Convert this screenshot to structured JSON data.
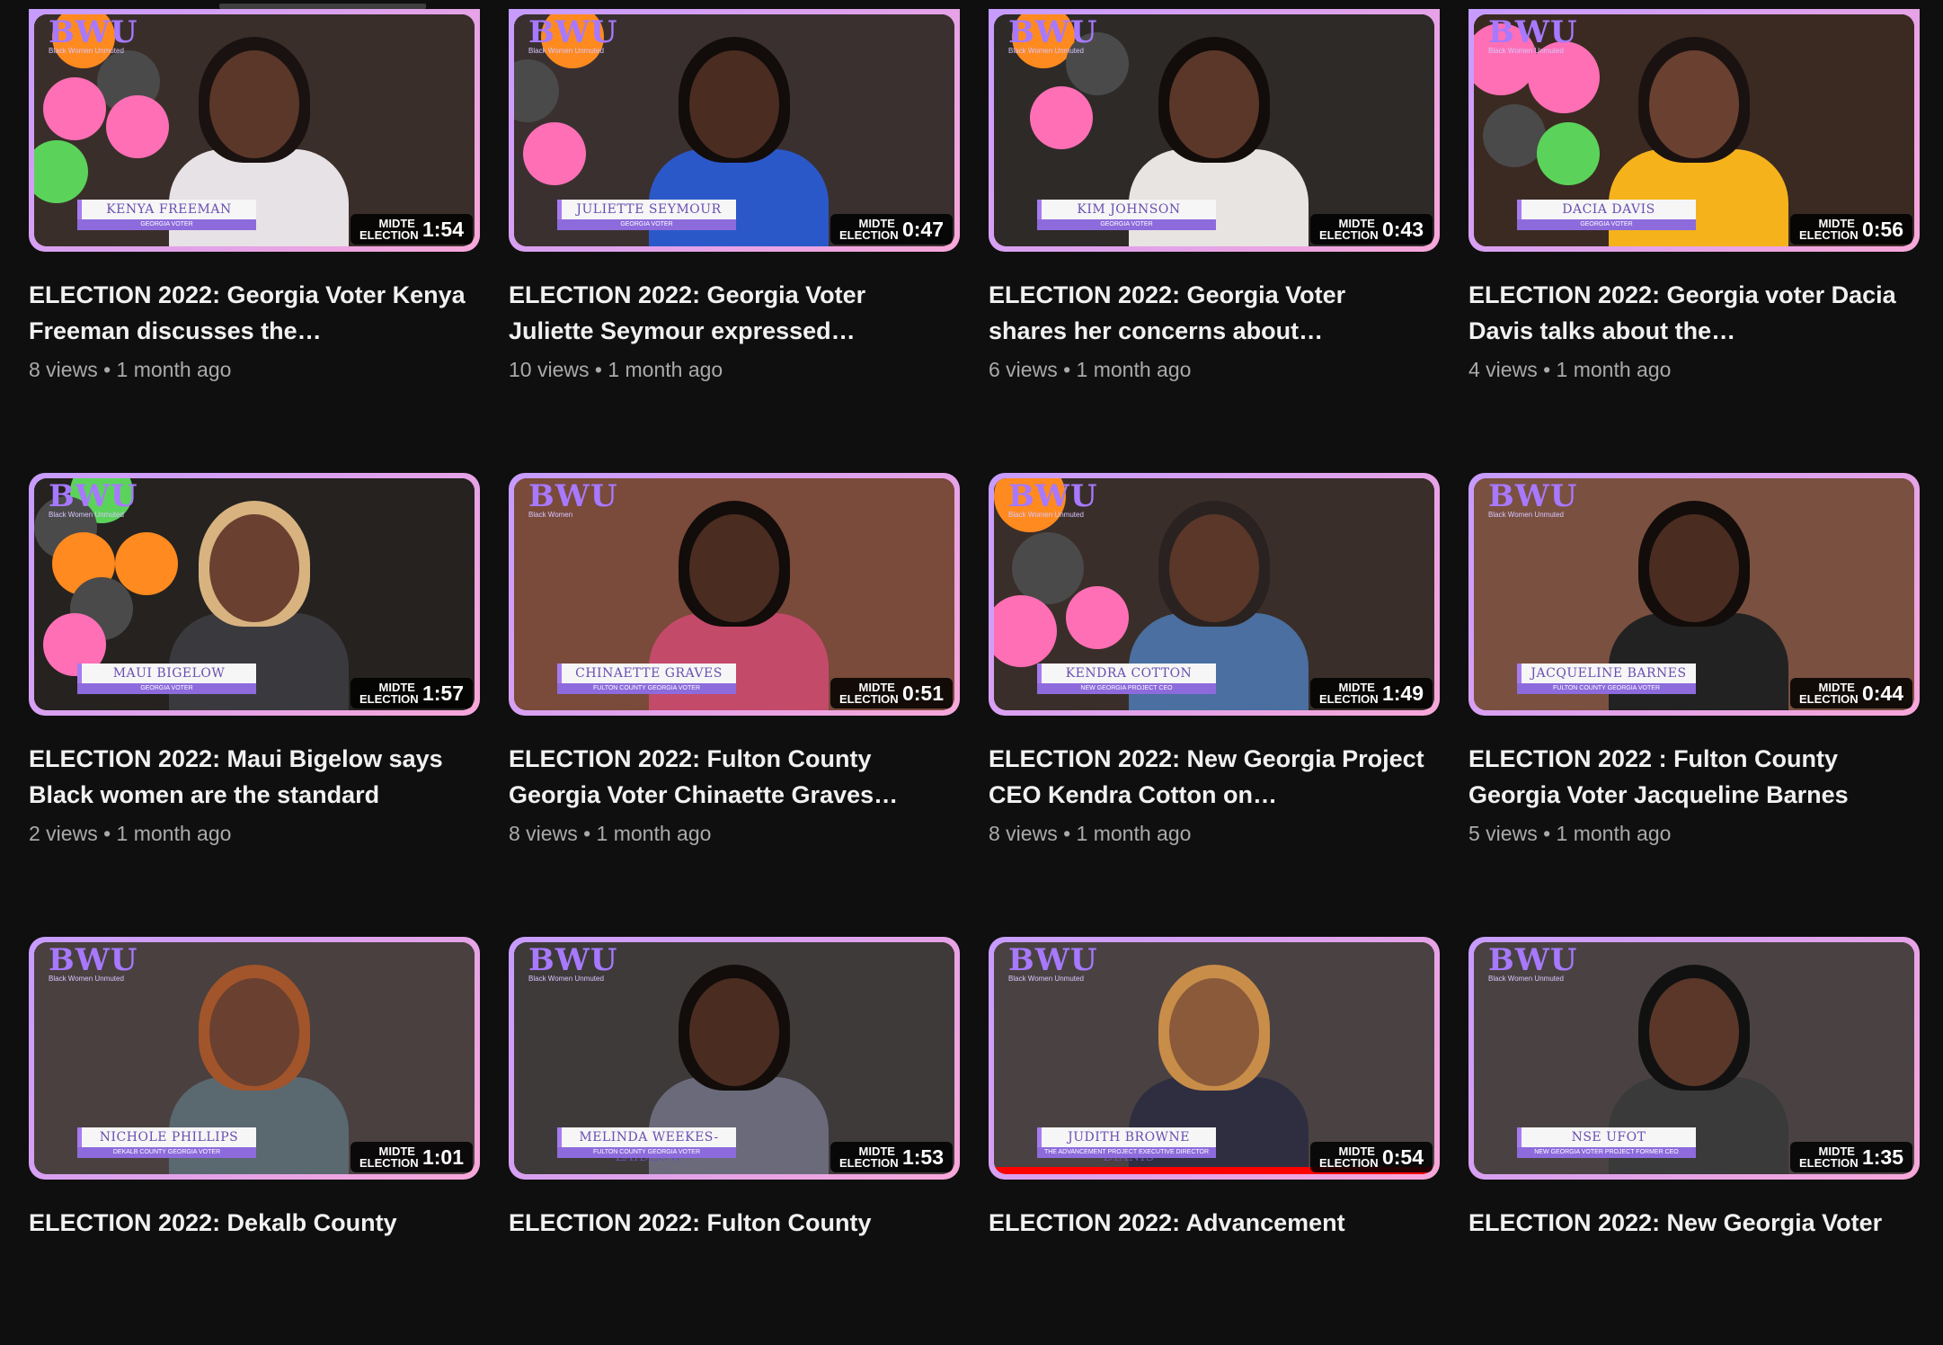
{
  "theme": {
    "background": "#0f0f0f",
    "accent_purple": "#a779ff",
    "pink_border": "#f7a7d9",
    "meta_gray": "#aaaaaa"
  },
  "videos": [
    {
      "title": "ELECTION 2022: Georgia Voter Kenya Freeman discusses the…",
      "views": "8 views",
      "age": "1 month ago",
      "duration": "1:54",
      "badge": "MIDTE ELECTION",
      "logo": "BWU",
      "logo_sub": "Black Women Unmuted",
      "nameplate": "Kenya Freeman",
      "nameplate_sub": "Georgia Voter"
    },
    {
      "title": "ELECTION 2022: Georgia Voter Juliette Seymour expressed…",
      "views": "10 views",
      "age": "1 month ago",
      "duration": "0:47",
      "badge": "MIDTE ELECTION",
      "logo": "BWU",
      "logo_sub": "Black Women Unmuted",
      "nameplate": "Juliette Seymour",
      "nameplate_sub": "Georgia Voter"
    },
    {
      "title": "ELECTION 2022: Georgia Voter shares her concerns about…",
      "views": "6 views",
      "age": "1 month ago",
      "duration": "0:43",
      "badge": "MIDTE ELECTION",
      "logo": "BWU",
      "logo_sub": "Black Women Unmuted",
      "nameplate": "Kim Johnson",
      "nameplate_sub": "Georgia Voter"
    },
    {
      "title": "ELECTION 2022: Georgia voter Dacia Davis talks about the…",
      "views": "4 views",
      "age": "1 month ago",
      "duration": "0:56",
      "badge": "MIDTE ELECTION",
      "logo": "BWU",
      "logo_sub": "Black Women Unmuted",
      "nameplate": "Dacia Davis",
      "nameplate_sub": "Georgia Voter"
    },
    {
      "title": "ELECTION 2022: Maui Bigelow says Black women are the standard",
      "views": "2 views",
      "age": "1 month ago",
      "duration": "1:57",
      "badge": "MIDTE ELECTION",
      "logo": "BWU",
      "logo_sub": "Black Women Unmuted",
      "nameplate": "Maui Bigelow",
      "nameplate_sub": "Georgia Voter"
    },
    {
      "title": "ELECTION 2022: Fulton County Georgia Voter Chinaette Graves…",
      "views": "8 views",
      "age": "1 month ago",
      "duration": "0:51",
      "badge": "MIDTE ELECTION",
      "logo": "BWU",
      "logo_sub": "Black Women",
      "nameplate": "Chinaette Graves",
      "nameplate_sub": "Fulton County Georgia Voter"
    },
    {
      "title": "ELECTION 2022: New Georgia Project CEO Kendra Cotton on…",
      "views": "8 views",
      "age": "1 month ago",
      "duration": "1:49",
      "badge": "MIDTE ELECTION",
      "logo": "BWU",
      "logo_sub": "Black Women Unmuted",
      "nameplate": "Kendra Cotton",
      "nameplate_sub": "New Georgia Project CEO"
    },
    {
      "title": "ELECTION 2022 : Fulton County Georgia Voter Jacqueline Barnes",
      "views": "5 views",
      "age": "1 month ago",
      "duration": "0:44",
      "badge": "MIDTE ELECTION",
      "logo": "BWU",
      "logo_sub": "Black Women Unmuted",
      "nameplate": "Jacqueline Barnes",
      "nameplate_sub": "Fulton County Georgia Voter"
    },
    {
      "title": "ELECTION 2022: Dekalb County",
      "views": "",
      "age": "",
      "duration": "1:01",
      "badge": "MIDTE ELECTION",
      "logo": "BWU",
      "logo_sub": "Black Women Unmuted",
      "nameplate": "Nichole Phillips",
      "nameplate_sub": "Dekalb County Georgia Voter"
    },
    {
      "title": "ELECTION 2022: Fulton County",
      "views": "",
      "age": "",
      "duration": "1:53",
      "badge": "MIDTE ELECTION",
      "logo": "BWU",
      "logo_sub": "Black Women Unmuted",
      "nameplate": "Melinda Weekes-Laidlow",
      "nameplate_sub": "Fulton County Georgia Voter"
    },
    {
      "title": "ELECTION 2022: Advancement",
      "views": "",
      "age": "",
      "duration": "0:54",
      "badge": "MIDTE ELECTION",
      "logo": "BWU",
      "logo_sub": "Black Women Unmuted",
      "nameplate": "Judith Browne Dianis",
      "nameplate_sub": "The Advancement Project Executive Director"
    },
    {
      "title": "ELECTION 2022: New Georgia Voter",
      "views": "",
      "age": "",
      "duration": "1:35",
      "badge": "MIDTE ELECTION",
      "logo": "BWU",
      "logo_sub": "Black Women Unmuted",
      "nameplate": "Nse Ufot",
      "nameplate_sub": "New Georgia Voter Project Former CEO"
    }
  ]
}
